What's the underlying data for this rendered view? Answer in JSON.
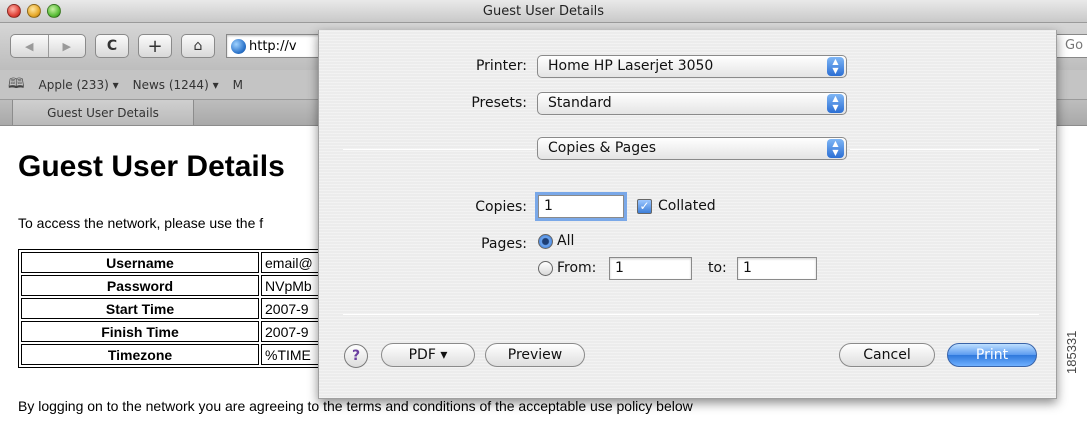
{
  "window": {
    "title": "Guest User Details"
  },
  "toolbar": {
    "back_glyph": "◀",
    "forward_glyph": "▶",
    "reload_glyph": "C",
    "add_glyph": "+",
    "home_glyph": "⌂",
    "address": "http://v",
    "search_fragment": "Go"
  },
  "bookmarks": {
    "icon": "book-icon",
    "items": [
      "Apple (233) ▾",
      "News (1244) ▾",
      "M"
    ]
  },
  "tab": {
    "label": "Guest User Details"
  },
  "page": {
    "title": "Guest User Details",
    "intro": "To access the network, please use the f",
    "rows": [
      {
        "key": "Username",
        "value": "email@"
      },
      {
        "key": "Password",
        "value": "NVpMb"
      },
      {
        "key": "Start Time",
        "value": "2007-9"
      },
      {
        "key": "Finish Time",
        "value": "2007-9"
      },
      {
        "key": "Timezone",
        "value": "%TIME"
      }
    ],
    "footer": "By logging on to the network you are agreeing to the terms and conditions of the acceptable use policy below"
  },
  "print_dialog": {
    "printer_label": "Printer:",
    "printer_value": "Home HP Laserjet 3050",
    "presets_label": "Presets:",
    "presets_value": "Standard",
    "section_value": "Copies & Pages",
    "copies_label": "Copies:",
    "copies_value": "1",
    "collated_label": "Collated",
    "collated_checked": true,
    "pages_label": "Pages:",
    "all_label": "All",
    "from_label": "From:",
    "from_value": "1",
    "to_label": "to:",
    "to_value": "1",
    "help_glyph": "?",
    "pdf_label": "PDF ▾",
    "preview_label": "Preview",
    "cancel_label": "Cancel",
    "print_label": "Print",
    "accent_color": "#2f78dc"
  },
  "figure_id": "185331"
}
